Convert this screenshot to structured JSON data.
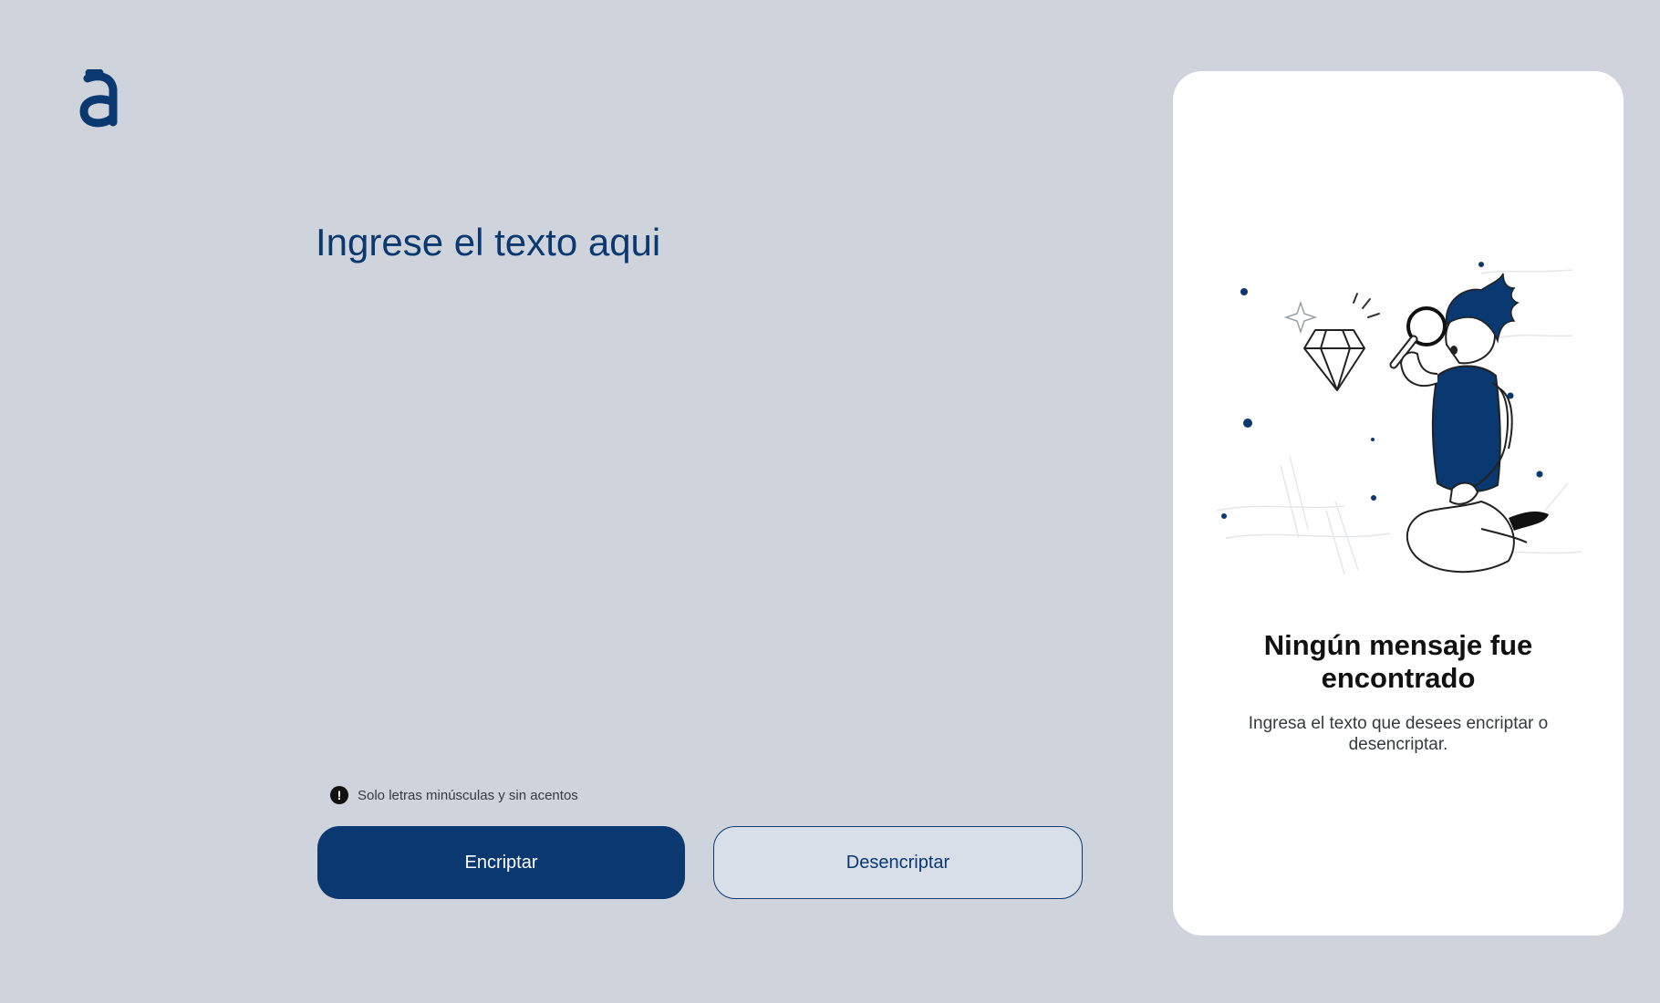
{
  "input": {
    "placeholder": "Ingrese el texto aqui",
    "value": ""
  },
  "hint": {
    "icon": "exclamation-circle-icon",
    "text": "Solo letras minúsculas y sin acentos"
  },
  "buttons": {
    "encrypt_label": "Encriptar",
    "decrypt_label": "Desencriptar"
  },
  "output_panel": {
    "title_line1": "Ningún mensaje fue",
    "title_line2": "encontrado",
    "subtitle": "Ingresa el texto que desees encriptar o desencriptar.",
    "illustration": "person-with-magnifying-glass-and-diamond"
  },
  "colors": {
    "background": "#cfd4dc",
    "primary": "#0a3871",
    "card": "#ffffff"
  }
}
